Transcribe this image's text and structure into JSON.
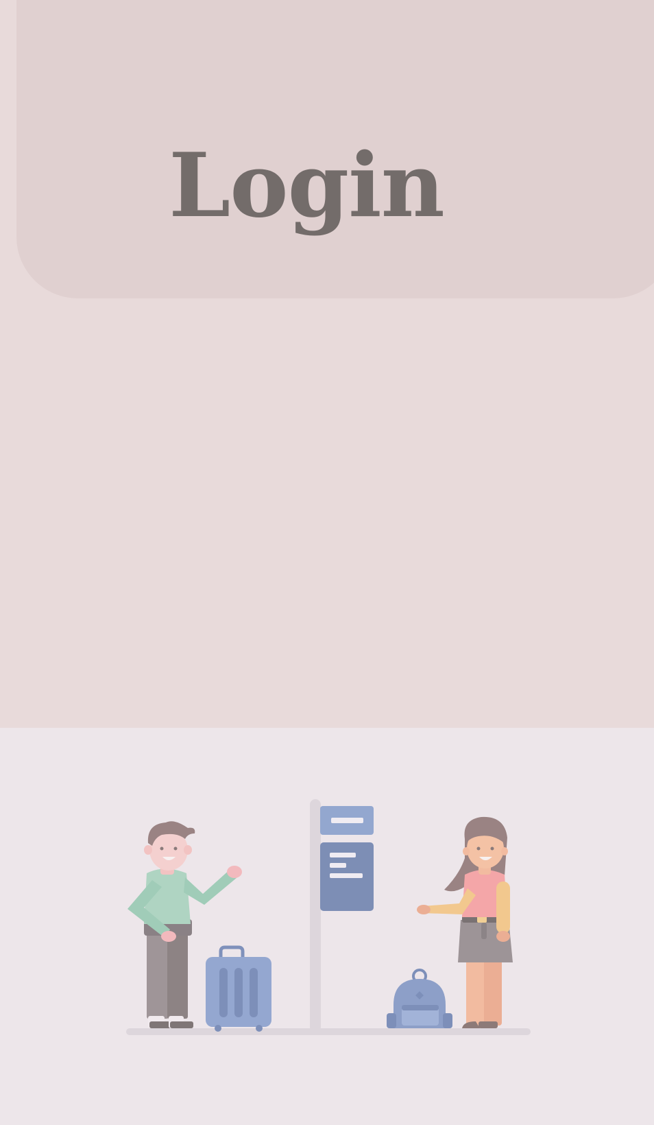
{
  "header": {
    "title": "Login"
  },
  "illustration": {
    "name": "travelers-at-bus-stop-illustration"
  },
  "colors": {
    "background": "#e8dada",
    "header_card": "#e0d0d0",
    "title_text": "#736c6a",
    "bottom_background": "#ede6ea"
  }
}
